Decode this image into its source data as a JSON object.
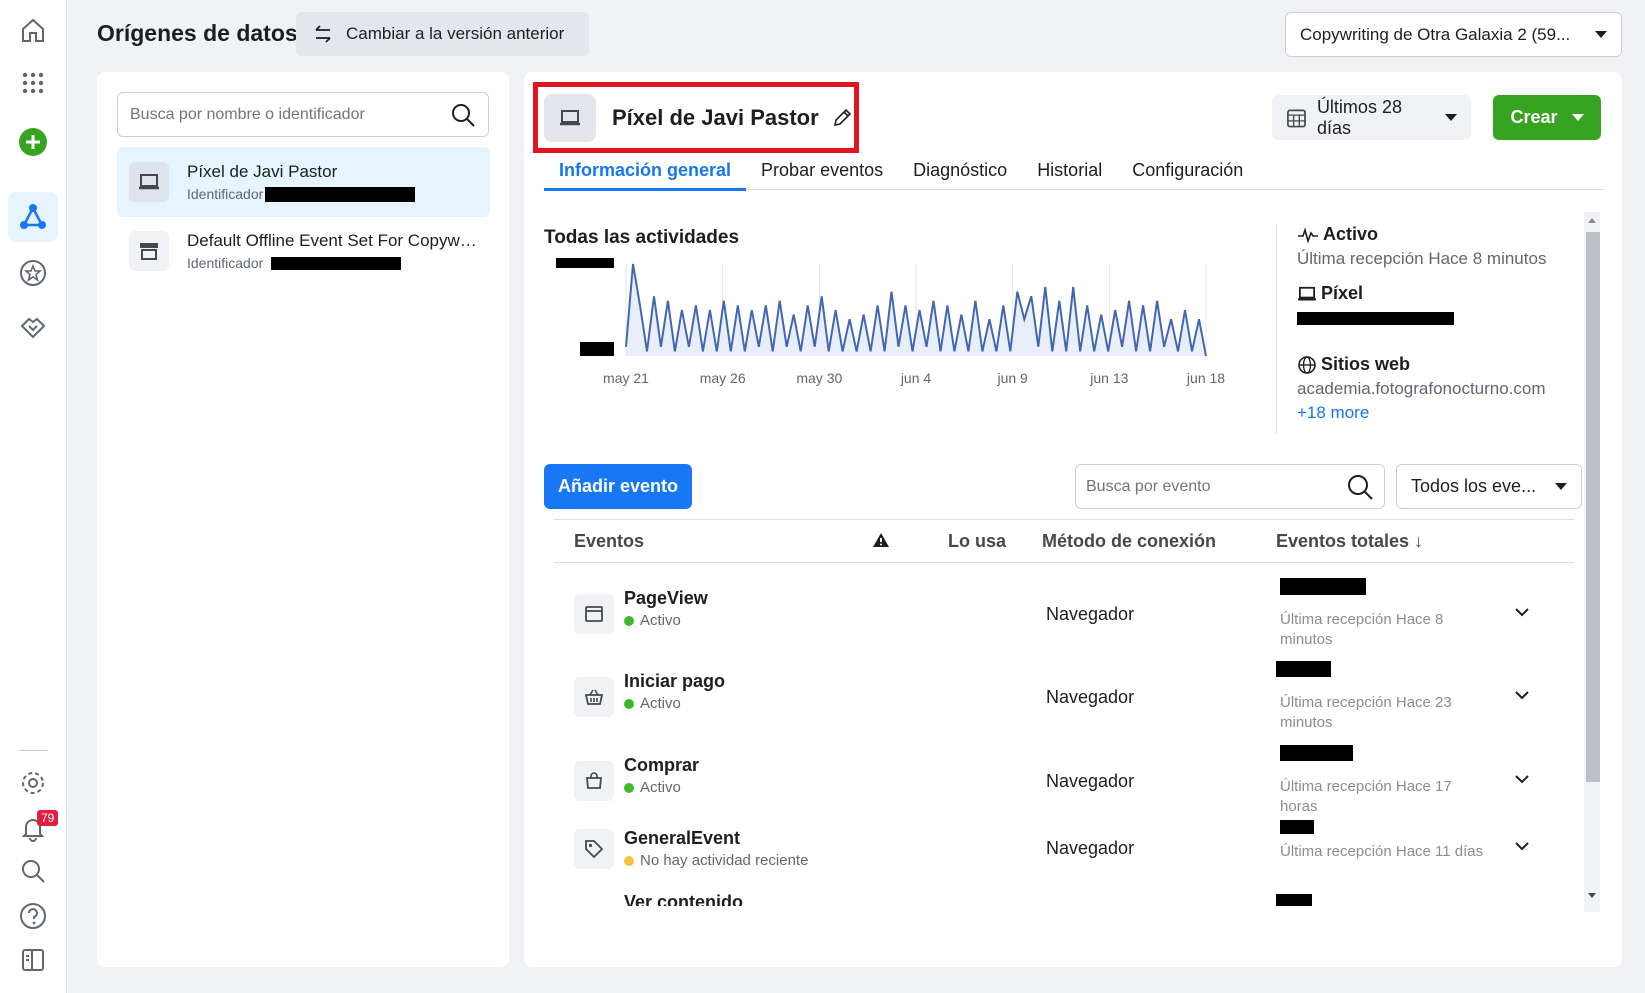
{
  "header": {
    "title": "Orígenes de datos",
    "switch_label": "Cambiar a la versión anterior",
    "account": "Copywriting de Otra Galaxia 2 (59..."
  },
  "rail": {
    "notifications_count": "79"
  },
  "sources": {
    "search_placeholder": "Busca por nombre o identificador",
    "items": [
      {
        "name": "Píxel de Javi Pastor",
        "id_label": "Identificador"
      },
      {
        "name": "Default Offline Event Set For Copywr...",
        "id_label": "Identificador"
      }
    ]
  },
  "pixel": {
    "name": "Píxel de Javi Pastor",
    "date_range": "Últimos 28 días",
    "create_label": "Crear",
    "tabs": [
      "Información general",
      "Probar eventos",
      "Diagnóstico",
      "Historial",
      "Configuración"
    ]
  },
  "activity": {
    "title": "Todas las actividades",
    "status_label": "Activo",
    "status_text": "Última recepción Hace 8 minutos",
    "pixel_label": "Píxel",
    "websites_label": "Sitios web",
    "website": "academia.fotografonocturno.com",
    "more": "+18 more"
  },
  "chart_data": {
    "type": "line",
    "title": "Todas las actividades",
    "x_ticks": [
      "may 21",
      "may 26",
      "may 30",
      "jun 4",
      "jun 9",
      "jun 13",
      "jun 18"
    ],
    "y_ticks_redacted": true,
    "series": [
      {
        "values": [
          0.1,
          1.0,
          0.55,
          0.05,
          0.65,
          0.1,
          0.6,
          0.05,
          0.5,
          0.1,
          0.55,
          0.05,
          0.5,
          0.05,
          0.6,
          0.05,
          0.55,
          0.05,
          0.5,
          0.1,
          0.55,
          0.05,
          0.6,
          0.1,
          0.45,
          0.05,
          0.55,
          0.1,
          0.65,
          0.05,
          0.5,
          0.05,
          0.4,
          0.05,
          0.45,
          0.05,
          0.55,
          0.05,
          0.7,
          0.1,
          0.55,
          0.05,
          0.5,
          0.1,
          0.6,
          0.05,
          0.55,
          0.05,
          0.45,
          0.05,
          0.6,
          0.05,
          0.4,
          0.05,
          0.55,
          0.05,
          0.7,
          0.4,
          0.65,
          0.1,
          0.75,
          0.05,
          0.6,
          0.05,
          0.75,
          0.05,
          0.55,
          0.05,
          0.45,
          0.05,
          0.5,
          0.1,
          0.6,
          0.05,
          0.55,
          0.05,
          0.6,
          0.1,
          0.4,
          0.05,
          0.5,
          0.05,
          0.4,
          0.0
        ]
      }
    ]
  },
  "events": {
    "add_label": "Añadir evento",
    "search_placeholder": "Busca por evento",
    "filter_label": "Todos los eve...",
    "columns": {
      "events": "Eventos",
      "uses": "Lo usa",
      "method": "Método de conexión",
      "total": "Eventos totales ↓"
    },
    "rows": [
      {
        "name": "PageView",
        "status": "Activo",
        "status_color": "#42b72a",
        "method": "Navegador",
        "last": "Última recepción Hace 8 minutos"
      },
      {
        "name": "Iniciar pago",
        "status": "Activo",
        "status_color": "#42b72a",
        "method": "Navegador",
        "last": "Última recepción Hace 23 minutos"
      },
      {
        "name": "Comprar",
        "status": "Activo",
        "status_color": "#42b72a",
        "method": "Navegador",
        "last": "Última recepción Hace 17 horas"
      },
      {
        "name": "GeneralEvent",
        "status": "No hay actividad reciente",
        "status_color": "#f5c33b",
        "method": "Navegador",
        "last": "Última recepción Hace 11 días"
      },
      {
        "name": "Ver contenido",
        "status": "",
        "status_color": "#42b72a",
        "method": "",
        "last": ""
      }
    ]
  },
  "colors": {
    "accent": "#1877f2",
    "create": "#36a420",
    "highlight": "#e0141e",
    "line": "#4267b2"
  }
}
